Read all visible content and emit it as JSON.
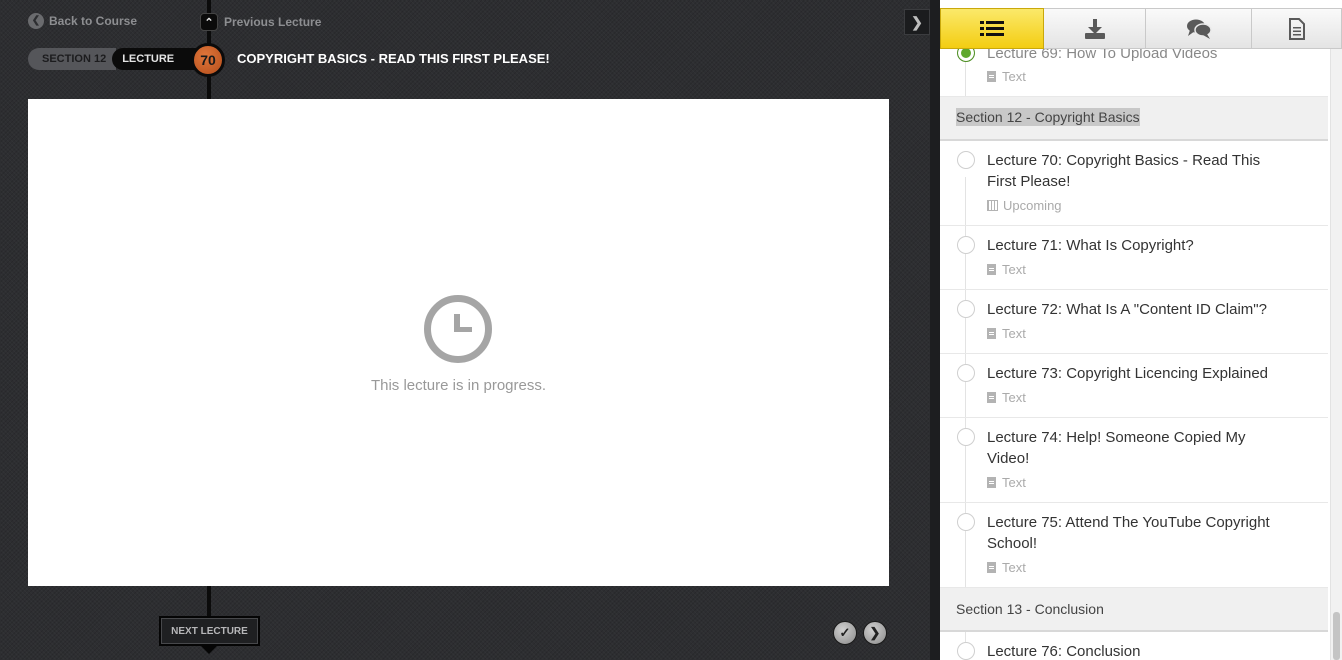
{
  "nav": {
    "back_label": "Back to Course",
    "prev_label": "Previous Lecture",
    "section_label": "SECTION 12",
    "lecture_label": "LECTURE",
    "lecture_number": "70",
    "lecture_title": "COPYRIGHT BASICS - READ THIS FIRST PLEASE!"
  },
  "content": {
    "status_text": "This lecture is in progress."
  },
  "footer": {
    "next_label": "NEXT LECTURE"
  },
  "tabs": [
    {
      "name": "list-icon",
      "active": true
    },
    {
      "name": "download-icon",
      "active": false
    },
    {
      "name": "comments-icon",
      "active": false
    },
    {
      "name": "notes-icon",
      "active": false
    }
  ],
  "curriculum": {
    "prev_item": {
      "title": "Lecture 69: How To Upload Videos",
      "meta": "Text",
      "done": true
    },
    "section12": {
      "title": "Section 12 - Copyright Basics"
    },
    "items": [
      {
        "title": "Lecture 70: Copyright Basics - Read This First Please!",
        "meta": "Upcoming"
      },
      {
        "title": "Lecture 71: What Is Copyright?",
        "meta": "Text"
      },
      {
        "title": "Lecture 72: What Is A \"Content ID Claim\"?",
        "meta": "Text"
      },
      {
        "title": "Lecture 73: Copyright Licencing Explained",
        "meta": "Text"
      },
      {
        "title": "Lecture 74: Help! Someone Copied My Video!",
        "meta": "Text"
      },
      {
        "title": "Lecture 75: Attend The YouTube Copyright School!",
        "meta": "Text"
      }
    ],
    "section13": {
      "title": "Section 13 - Conclusion"
    },
    "last_item": {
      "title": "Lecture 76: Conclusion"
    }
  },
  "colors": {
    "accent_tab": "#f3cd12",
    "lecture_badge": "#c9602a",
    "complete_dot": "#5fa82e"
  }
}
